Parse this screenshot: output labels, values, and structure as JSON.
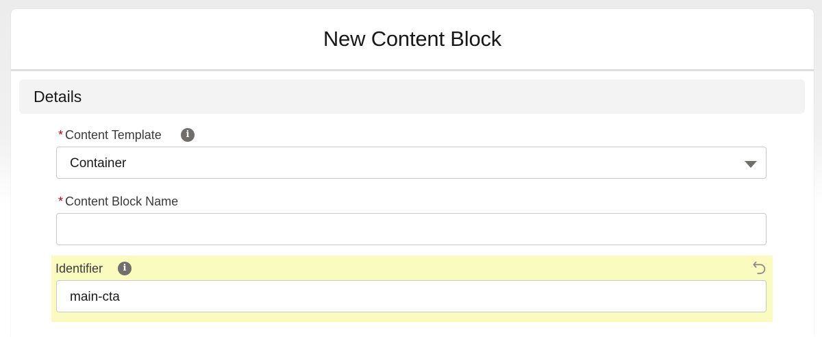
{
  "modal": {
    "title": "New Content Block"
  },
  "section": {
    "title": "Details"
  },
  "fields": {
    "content_template": {
      "required_mark": "*",
      "label": "Content Template",
      "value": "Container"
    },
    "content_block_name": {
      "required_mark": "*",
      "label": "Content Block Name",
      "value": ""
    },
    "identifier": {
      "label": "Identifier",
      "value": "main-cta"
    }
  },
  "icons": {
    "info": "i",
    "info_name": "info-icon",
    "undo_name": "undo-icon",
    "dropdown_name": "chevron-down-icon"
  },
  "colors": {
    "required": "#ba0517",
    "changed_highlight": "#fafbbe",
    "section_background": "#f3f3f3",
    "icon_gray": "#706e6b"
  }
}
